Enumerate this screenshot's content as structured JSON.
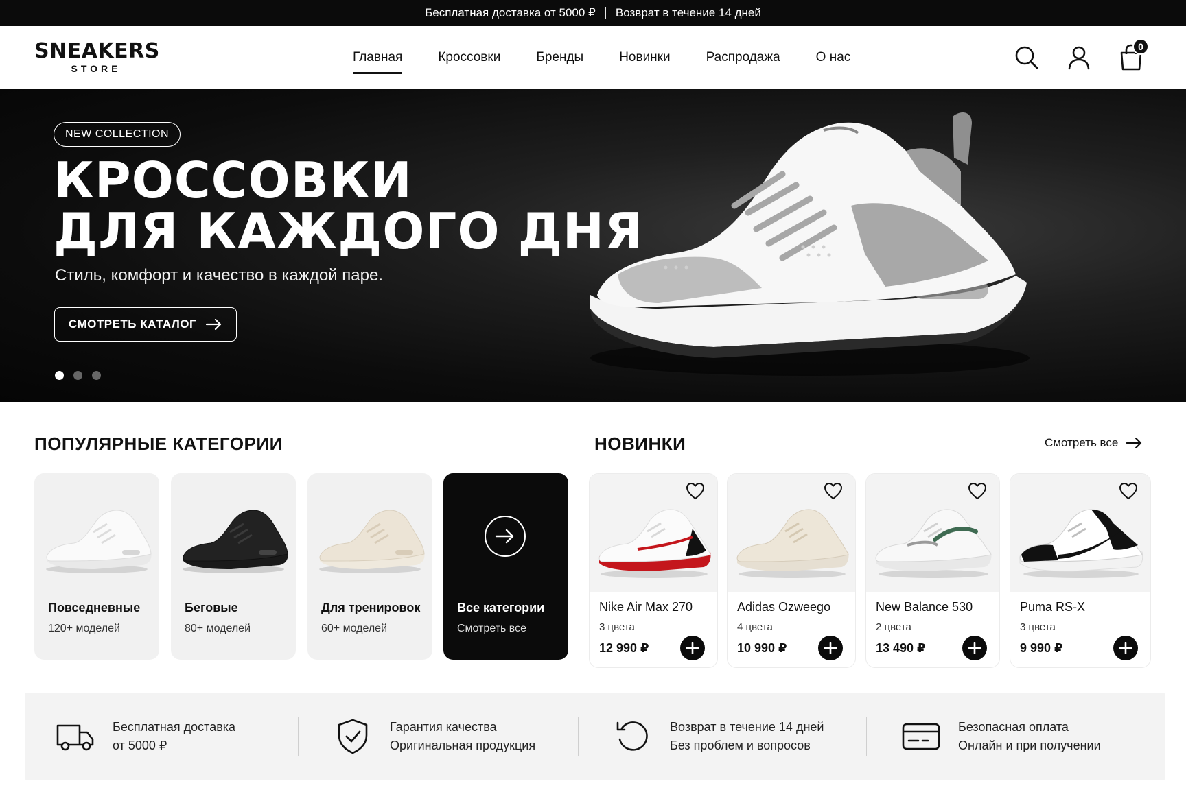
{
  "promo": {
    "left": "Бесплатная доставка от 5000 ₽",
    "right": "Возврат в течение 14 дней"
  },
  "logo": {
    "line1": "SNEAKERS",
    "line2": "STORE"
  },
  "nav": {
    "items": [
      {
        "label": "Главная"
      },
      {
        "label": "Кроссовки"
      },
      {
        "label": "Бренды"
      },
      {
        "label": "Новинки"
      },
      {
        "label": "Распродажа"
      },
      {
        "label": "О нас"
      }
    ],
    "active": "Главная"
  },
  "header_icons": {
    "search": "search-icon",
    "account": "user-icon",
    "cart": "shopping-bag-icon",
    "cart_count": "0"
  },
  "hero": {
    "badge": "NEW COLLECTION",
    "title_line1": "КРОССОВКИ",
    "title_line2": "ДЛЯ КАЖДОГО ДНЯ",
    "subtitle": "Стиль, комфорт и качество в каждой паре.",
    "cta": "СМОТРЕТЬ КАТАЛОГ",
    "slides_total": 3,
    "active_slide": 1
  },
  "categories": {
    "title": "ПОПУЛЯРНЫЕ КАТЕГОРИИ",
    "items": [
      {
        "name": "Повседневные",
        "count": "120+ моделей",
        "color": "white"
      },
      {
        "name": "Беговые",
        "count": "80+ моделей",
        "color": "black"
      },
      {
        "name": "Для тренировок",
        "count": "60+ моделей",
        "color": "beige"
      },
      {
        "name": "Все категории",
        "count": "Смотреть все"
      }
    ]
  },
  "new_arrivals": {
    "title": "НОВИНКИ",
    "see_all": "Смотреть все",
    "products": [
      {
        "name": "Nike Air Max 270",
        "colors": "3 цвета",
        "price": "12 990 ₽",
        "accent": "#c4161c"
      },
      {
        "name": "Adidas Ozweego",
        "colors": "4 цвета",
        "price": "10 990 ₽",
        "accent": "#e8e0d2"
      },
      {
        "name": "New Balance 530",
        "colors": "2 цвета",
        "price": "13 490 ₽",
        "accent": "#3f6b52"
      },
      {
        "name": "Puma RS-X",
        "colors": "3 цвета",
        "price": "9 990 ₽",
        "accent": "#111111"
      }
    ]
  },
  "features": [
    {
      "icon": "truck-icon",
      "line1": "Бесплатная доставка",
      "line2": "от 5000 ₽"
    },
    {
      "icon": "shield-check-icon",
      "line1": "Гарантия качества",
      "line2": "Оригинальная продукция"
    },
    {
      "icon": "return-icon",
      "line1": "Возврат в течение 14 дней",
      "line2": "Без проблем и вопросов"
    },
    {
      "icon": "credit-card-icon",
      "line1": "Безопасная оплата",
      "line2": "Онлайн и при получении"
    }
  ]
}
